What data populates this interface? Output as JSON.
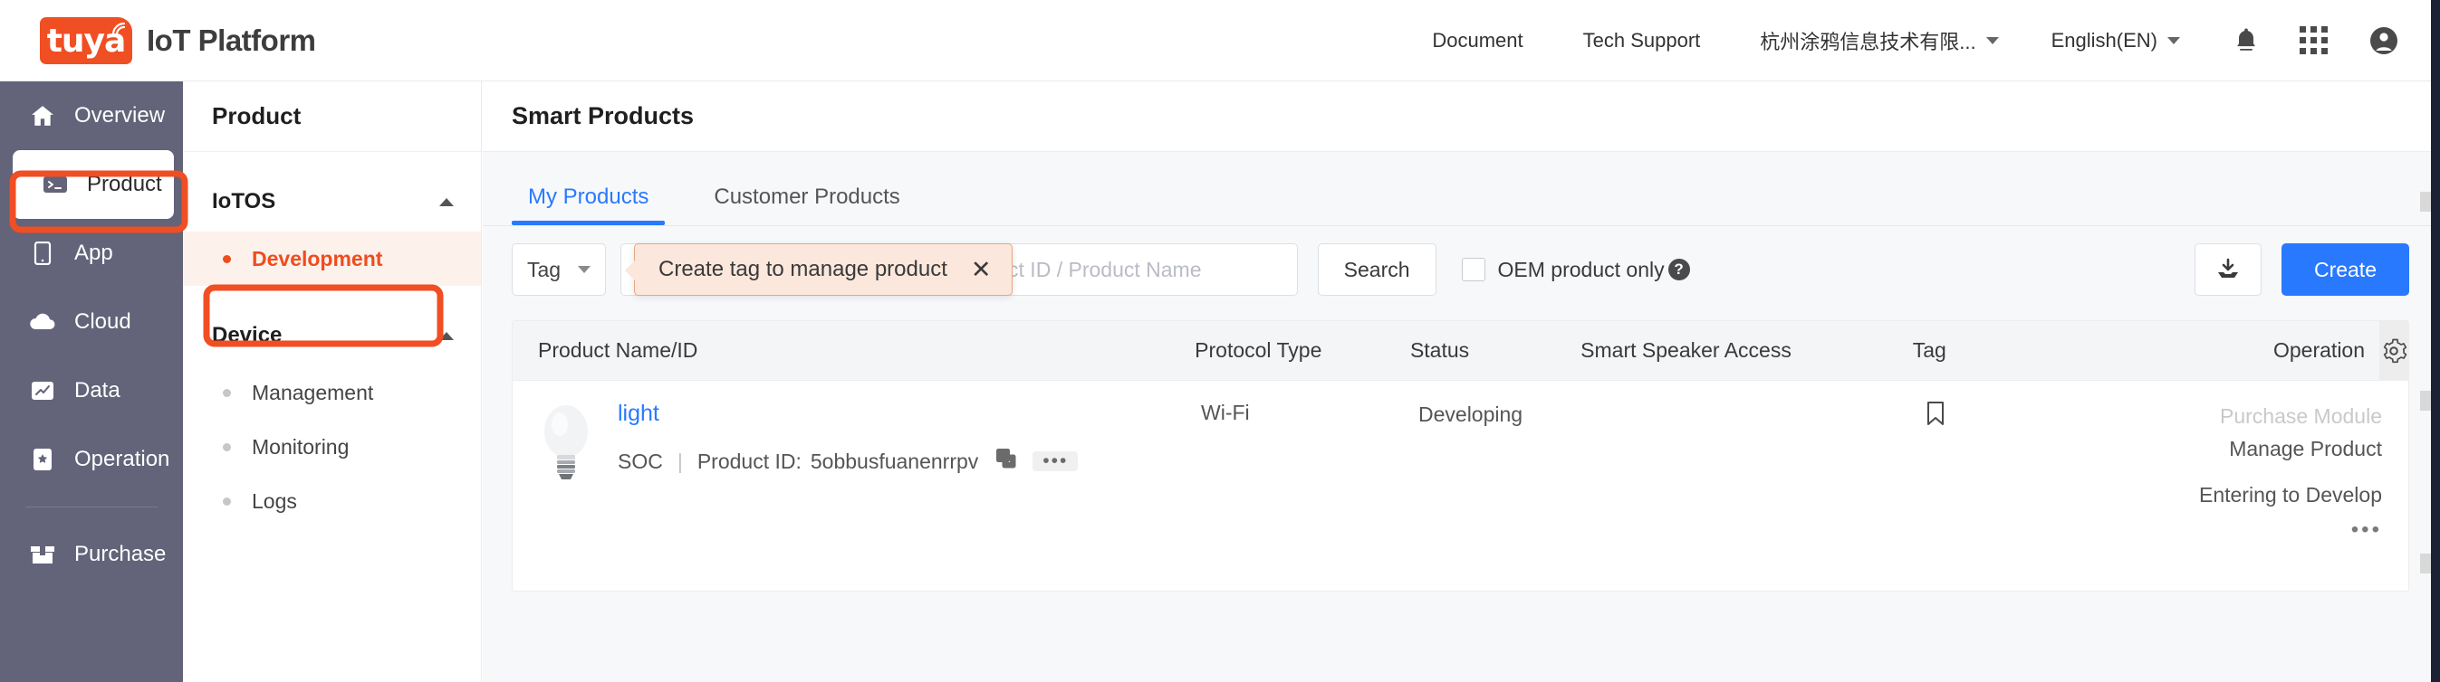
{
  "header": {
    "logo_word": "tuya",
    "logo_icon": "wifi-wave-icon",
    "brand_title": "IoT Platform",
    "nav": [
      {
        "label": "Document",
        "type": "link"
      },
      {
        "label": "Tech Support",
        "type": "link"
      }
    ],
    "org_dropdown": "杭州涂鸦信息技术有限...",
    "language_dropdown": "English(EN)",
    "icons": [
      "bell-icon",
      "apps-grid-icon",
      "user-avatar-icon"
    ]
  },
  "rail": {
    "items": [
      {
        "label": "Overview",
        "icon": "home-icon",
        "active": false
      },
      {
        "label": "Product",
        "icon": "terminal-icon",
        "active": true
      },
      {
        "label": "App",
        "icon": "mobile-icon",
        "active": false
      },
      {
        "label": "Cloud",
        "icon": "cloud-icon",
        "active": false
      },
      {
        "label": "Data",
        "icon": "chart-icon",
        "active": false
      },
      {
        "label": "Operation",
        "icon": "bookmark-star-icon",
        "active": false
      },
      {
        "label": "Purchase",
        "icon": "box-icon",
        "active": false
      }
    ]
  },
  "panel": {
    "title": "Product",
    "groups": [
      {
        "label": "IoTOS",
        "items": [
          {
            "label": "Development",
            "selected": true
          }
        ]
      },
      {
        "label": "Device",
        "items": [
          {
            "label": "Management",
            "selected": false
          },
          {
            "label": "Monitoring",
            "selected": false
          },
          {
            "label": "Logs",
            "selected": false
          }
        ]
      }
    ]
  },
  "main": {
    "page_title": "Smart Products",
    "tabs": [
      {
        "label": "My Products",
        "active": true
      },
      {
        "label": "Customer Products",
        "active": false
      }
    ],
    "toolbar": {
      "tag_select": "Tag",
      "hidden_select": "r",
      "search_label": "Product ID",
      "search_value": "",
      "search_placeholder": "Product ID / Product Name",
      "search_button": "Search",
      "oem_checkbox_label": "OEM product only",
      "oem_checkbox_checked": false,
      "help_icon": "question-mark-icon",
      "download_icon": "download-icon",
      "create_button": "Create"
    },
    "tooltip": {
      "text": "Create tag to manage product",
      "close_icon": "close-x-icon"
    },
    "table": {
      "columns": [
        "Product Name/ID",
        "Protocol Type",
        "Status",
        "Smart Speaker Access",
        "Tag",
        "Operation"
      ],
      "settings_icon": "gear-icon",
      "rows": [
        {
          "thumb_icon": "light-bulb-icon",
          "name": "light",
          "category": "SOC",
          "product_id_label": "Product ID:",
          "product_id": "5obbusfuanenrrpv",
          "copy_icon": "copy-icon",
          "more_icon": "ellipsis-icon",
          "protocol": "Wi-Fi",
          "status": "Developing",
          "speaker_access": "",
          "tag_icon": "bookmark-outline-icon",
          "operations": [
            {
              "label": "Purchase Module",
              "disabled": true
            },
            {
              "label": "Manage Product",
              "disabled": false
            },
            {
              "label": "Entering to Develop",
              "disabled": false
            }
          ],
          "operations_more": "•••"
        }
      ]
    }
  },
  "colors": {
    "brand_orange": "#f04e23",
    "accent_blue": "#2979ff",
    "rail_bg": "#63637a",
    "highlight_orange": "#ee4d1e",
    "tooltip_bg": "#fbe7dc"
  }
}
